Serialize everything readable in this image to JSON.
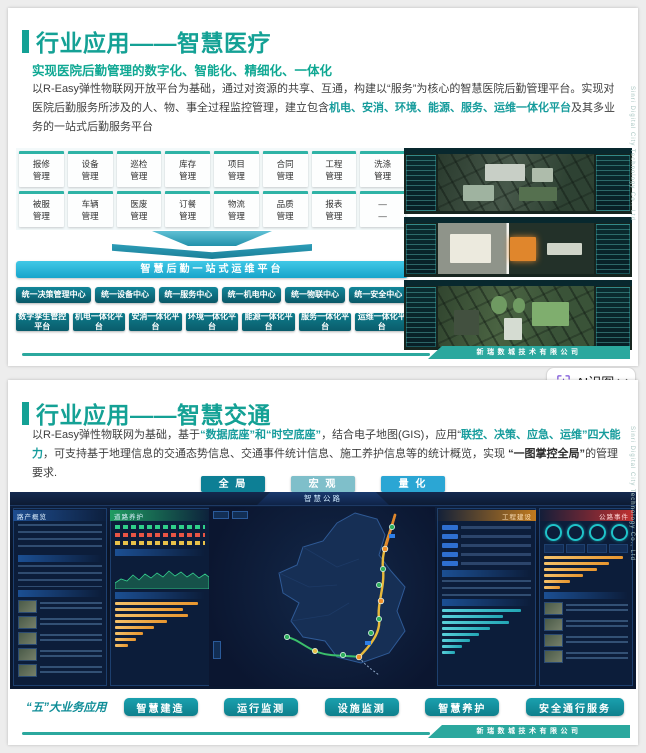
{
  "branding": {
    "company": "新瑞数城技术有限公司",
    "side_text": "Sinri Digital City Technology Co., Ltd"
  },
  "ai_tool": {
    "label": "AI识图",
    "icon": "scan-sparkle-icon"
  },
  "slide1": {
    "title": "行业应用——智慧医疗",
    "subtitle": "实现医院后勤管理的数字化、智能化、精细化、一体化",
    "body": {
      "s1": "以R-Easy弹性物联网开放平台为基础，通过对资源的共享、互通，构建以“服务”为核心的智慧医院后勤管理平台。实现对医院后勤服务所涉及的人、物、事全过程监控管理，建立包含",
      "s2": "机电、安消、环境、能源、服务、运维一体化平台",
      "s3": "及其多业务的一站式后勤服务平台"
    },
    "modules": [
      {
        "l1": "报修",
        "l2": "管理"
      },
      {
        "l1": "设备",
        "l2": "管理"
      },
      {
        "l1": "巡检",
        "l2": "管理"
      },
      {
        "l1": "库存",
        "l2": "管理"
      },
      {
        "l1": "项目",
        "l2": "管理"
      },
      {
        "l1": "合同",
        "l2": "管理"
      },
      {
        "l1": "工程",
        "l2": "管理"
      },
      {
        "l1": "洗涤",
        "l2": "管理"
      },
      {
        "l1": "被服",
        "l2": "管理"
      },
      {
        "l1": "车辆",
        "l2": "管理"
      },
      {
        "l1": "医废",
        "l2": "管理"
      },
      {
        "l1": "订餐",
        "l2": "管理"
      },
      {
        "l1": "物流",
        "l2": "管理"
      },
      {
        "l1": "品质",
        "l2": "管理"
      },
      {
        "l1": "报表",
        "l2": "管理"
      },
      {
        "l1": "—",
        "l2": "—"
      }
    ],
    "banner": "智慧后勤一站式运维平台",
    "centers": [
      "统一决策管理中心",
      "统一设备中心",
      "统一服务中心",
      "统一机电中心",
      "统一物联中心",
      "统一安全中心"
    ],
    "platforms": [
      "数字孪生管控平台",
      "机电一体化平台",
      "安消一体化平台",
      "环境一体化平台",
      "能源一体化平台",
      "服务一体化平台",
      "运维一体化平台"
    ]
  },
  "slide2": {
    "title": "行业应用——智慧交通",
    "body": {
      "s1": "以R-Easy弹性物联网为基础，基于",
      "s2": "“数据底座”和“时空底座”",
      "s3": "，结合电子地图(GIS)，应用“",
      "s4": "联控、决策、应急、运维”四大能力",
      "s5": "，可支持基于地理信息的交通态势信息、交通事件统计信息、施工养护信息等的统计概览，实现 ",
      "s6": "“一图掌控全局”",
      "s7": "的管理要求."
    },
    "view_buttons": {
      "global": "全 局",
      "macro": "宏 观",
      "quant": "量 化"
    },
    "dashboard": {
      "center_title": "智慧公路",
      "panel_left": "路产概览",
      "panel_mid": "道路养护",
      "panel_right1": "工程建设",
      "panel_right2": "公路事件"
    },
    "business": {
      "label": "“五”大业务应用",
      "buttons": [
        "智慧建造",
        "运行监测",
        "设施监测",
        "智慧养护",
        "安全通行服务"
      ]
    }
  }
}
